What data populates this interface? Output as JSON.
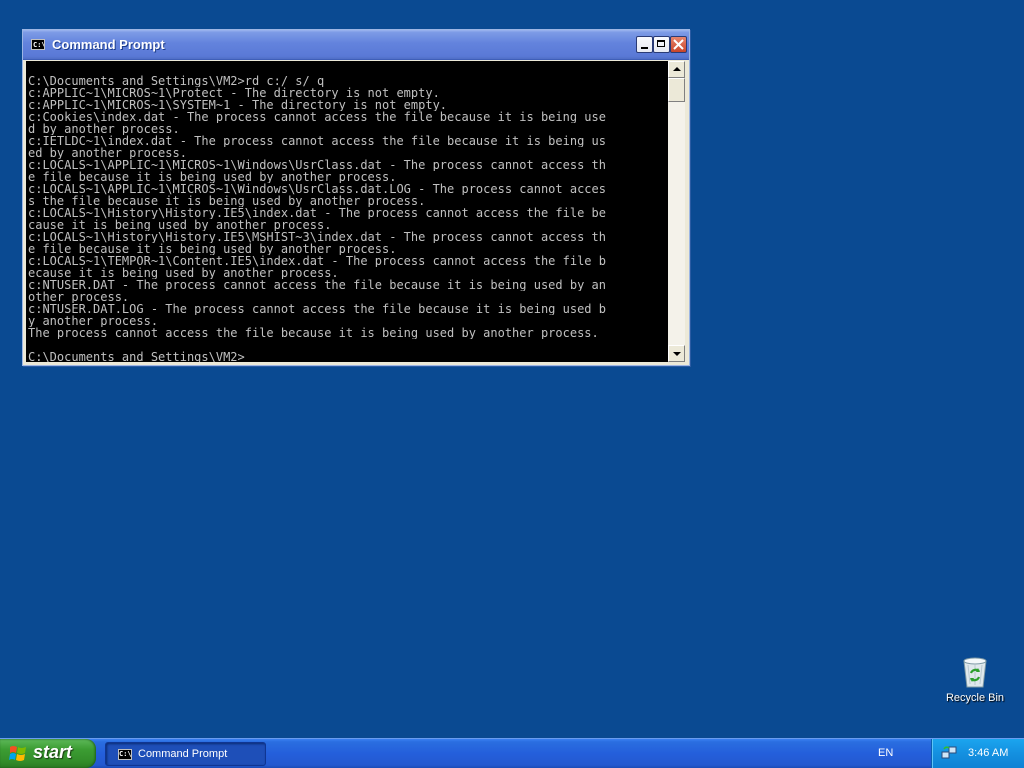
{
  "window": {
    "title": "Command Prompt",
    "icon_text": "C:\\",
    "icon": "console-icon"
  },
  "console": {
    "lines": [
      "",
      "C:\\Documents and Settings\\VM2>rd c:/ s/ q",
      "c:APPLIC~1\\MICROS~1\\Protect - The directory is not empty.",
      "c:APPLIC~1\\MICROS~1\\SYSTEM~1 - The directory is not empty.",
      "c:Cookies\\index.dat - The process cannot access the file because it is being use",
      "d by another process.",
      "c:IETLDC~1\\index.dat - The process cannot access the file because it is being us",
      "ed by another process.",
      "c:LOCALS~1\\APPLIC~1\\MICROS~1\\Windows\\UsrClass.dat - The process cannot access th",
      "e file because it is being used by another process.",
      "c:LOCALS~1\\APPLIC~1\\MICROS~1\\Windows\\UsrClass.dat.LOG - The process cannot acces",
      "s the file because it is being used by another process.",
      "c:LOCALS~1\\History\\History.IE5\\index.dat - The process cannot access the file be",
      "cause it is being used by another process.",
      "c:LOCALS~1\\History\\History.IE5\\MSHIST~3\\index.dat - The process cannot access th",
      "e file because it is being used by another process.",
      "c:LOCALS~1\\TEMPOR~1\\Content.IE5\\index.dat - The process cannot access the file b",
      "ecause it is being used by another process.",
      "c:NTUSER.DAT - The process cannot access the file because it is being used by an",
      "other process.",
      "c:NTUSER.DAT.LOG - The process cannot access the file because it is being used b",
      "y another process.",
      "The process cannot access the file because it is being used by another process.",
      "",
      "C:\\Documents and Settings\\VM2>"
    ]
  },
  "desktop": {
    "recycle_bin_label": "Recycle Bin",
    "recycle_bin_icon": "recycle-bin-icon"
  },
  "taskbar": {
    "start_label": "start",
    "task_label": "Command Prompt",
    "task_icon_text": "C:\\",
    "language": "EN",
    "clock": "3:46 AM"
  },
  "colors": {
    "desktop": "#0a4a92",
    "console_bg": "#000000",
    "console_text": "#c0c0c0",
    "taskbar": "#245fdb",
    "start_button": "#3c9d33"
  }
}
